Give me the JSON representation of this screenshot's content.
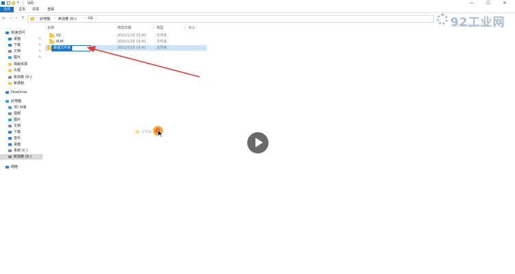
{
  "window": {
    "title": "UG",
    "min_glyph": "—",
    "max_glyph": "☐",
    "close_glyph": "✕"
  },
  "ribbon": {
    "tabs": [
      {
        "label": "文件",
        "active": true
      },
      {
        "label": "主页"
      },
      {
        "label": "共享"
      },
      {
        "label": "查看"
      }
    ]
  },
  "nav": {
    "back": "←",
    "forward": "→",
    "recent": "⌄",
    "up": "↑",
    "breadcrumb": [
      "此电脑",
      "新加卷 (D:)",
      "UG"
    ],
    "separator": "›"
  },
  "sidebar": {
    "items": [
      {
        "label": "快速访问",
        "icon": "star-icon",
        "color": "#2f7fd6"
      },
      {
        "label": "桌面",
        "icon": "desktop-icon",
        "color": "#2f7fd6",
        "pinned": true
      },
      {
        "label": "下载",
        "icon": "download-icon",
        "color": "#2f7fd6",
        "pinned": true
      },
      {
        "label": "文档",
        "icon": "document-icon",
        "color": "#7a8a99",
        "pinned": true
      },
      {
        "label": "图片",
        "icon": "picture-icon",
        "color": "#3aa0d8",
        "pinned": true
      },
      {
        "label": "揭秘资源",
        "icon": "folder-icon",
        "color": "#f2c94c"
      },
      {
        "label": "片尾",
        "icon": "folder-icon",
        "color": "#f2c94c"
      },
      {
        "label": "新加卷 (D:)",
        "icon": "drive-icon",
        "color": "#7a8a99"
      },
      {
        "label": "新录制",
        "icon": "folder-icon",
        "color": "#f2c94c"
      },
      {
        "label": "OneDrive",
        "icon": "cloud-icon",
        "color": "#2f7fd6"
      },
      {
        "label": "此电脑",
        "icon": "computer-icon",
        "color": "#3aa0d8"
      },
      {
        "label": "3D 对象",
        "icon": "cube-icon",
        "color": "#3aa0d8"
      },
      {
        "label": "视频",
        "icon": "video-icon",
        "color": "#7a8a99"
      },
      {
        "label": "图片",
        "icon": "picture-icon",
        "color": "#3aa0d8"
      },
      {
        "label": "文档",
        "icon": "document-icon",
        "color": "#7a8a99"
      },
      {
        "label": "下载",
        "icon": "download-icon",
        "color": "#2f7fd6"
      },
      {
        "label": "音乐",
        "icon": "music-icon",
        "color": "#2f7fd6"
      },
      {
        "label": "桌面",
        "icon": "desktop-icon",
        "color": "#2f7fd6"
      },
      {
        "label": "系统 (C:)",
        "icon": "drive-icon",
        "color": "#7a8a99"
      },
      {
        "label": "新加卷 (D:)",
        "icon": "drive-icon",
        "color": "#7a8a99",
        "selected": true
      },
      {
        "label": "网络",
        "icon": "network-icon",
        "color": "#2f7fd6"
      }
    ],
    "pin_glyph": "✎"
  },
  "columns": {
    "name": "名称",
    "modified": "修改日期",
    "type": "类型",
    "size": "大小"
  },
  "files": [
    {
      "name": "UC",
      "modified": "2021/1/15 13:41",
      "type": "文件夹"
    },
    {
      "name": "PLM",
      "modified": "2021/1/15 13:41",
      "type": "文件夹"
    },
    {
      "name": "新建文件夹",
      "modified": "2021/1/15 13:41",
      "type": "文件夹",
      "renaming": true
    }
  ],
  "drag_ghost": {
    "label": "文件夹"
  },
  "watermark": {
    "main": "92工业网",
    "sub": "WWW.92GYW.COM"
  },
  "colors": {
    "accent": "#1a73c8",
    "selection": "#cce4f7",
    "arrow": "#e53935"
  }
}
